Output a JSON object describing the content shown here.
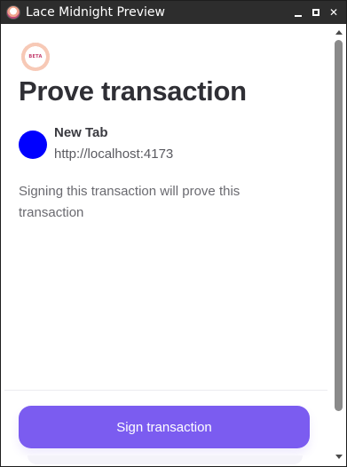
{
  "window": {
    "title": "Lace Midnight Preview",
    "icon": "lace-app-icon",
    "controls": [
      "minimize",
      "maximize",
      "close"
    ]
  },
  "logo": {
    "badge_text": "BETA"
  },
  "page": {
    "title": "Prove transaction"
  },
  "dapp": {
    "name": "New Tab",
    "url": "http://localhost:4173",
    "avatar_color": "#0000ff"
  },
  "description": "Signing this transaction will prove this transaction",
  "actions": {
    "sign_label": "Sign transaction"
  },
  "colors": {
    "accent": "#7b5cf0",
    "titlebar": "#2d2d2d",
    "heading": "#2f2f35"
  }
}
